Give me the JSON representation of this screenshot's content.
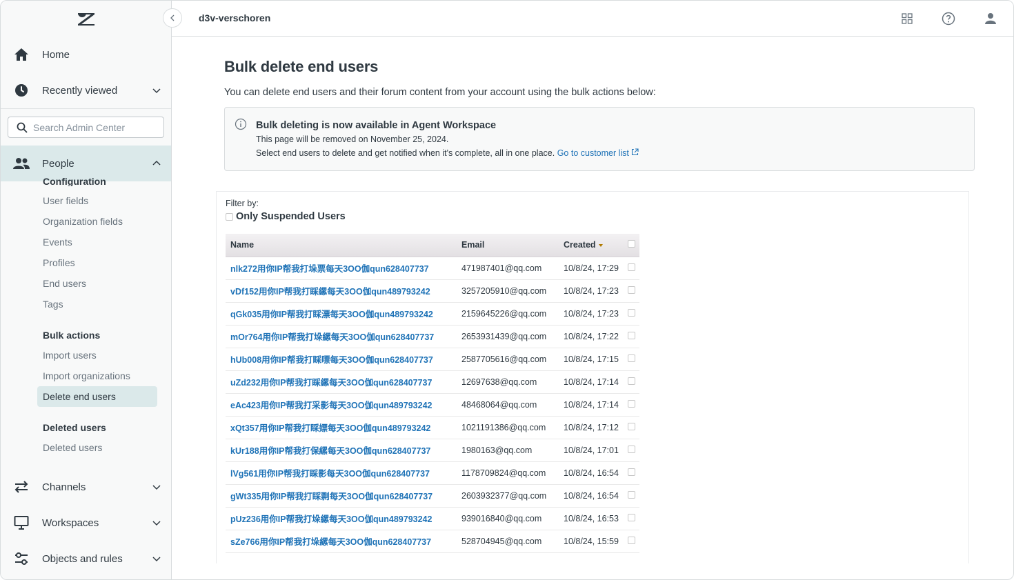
{
  "header": {
    "account_name": "d3v-verschoren"
  },
  "sidebar": {
    "home_label": "Home",
    "recently_viewed_label": "Recently viewed",
    "search_placeholder": "Search Admin Center",
    "people_label": "People",
    "clipped_section": "Configuration",
    "config_items": [
      "User fields",
      "Organization fields",
      "Events",
      "Profiles",
      "End users",
      "Tags"
    ],
    "bulk_actions_heading": "Bulk actions",
    "bulk_items": [
      "Import users",
      "Import organizations",
      "Delete end users"
    ],
    "deleted_heading": "Deleted users",
    "deleted_items": [
      "Deleted users"
    ],
    "channels_label": "Channels",
    "workspaces_label": "Workspaces",
    "objects_label": "Objects and rules"
  },
  "main": {
    "title": "Bulk delete end users",
    "intro": "You can delete end users and their forum content from your account using the bulk actions below:",
    "notice": {
      "title": "Bulk deleting is now available in Agent Workspace",
      "line1": "This page will be removed on November 25, 2024.",
      "line2": "Select end users to delete and get notified when it's complete, all in one place.",
      "link": "Go to customer list"
    },
    "filter": {
      "label": "Filter by:",
      "option": "Only Suspended Users"
    },
    "table": {
      "headers": {
        "name": "Name",
        "email": "Email",
        "created": "Created"
      },
      "rows": [
        {
          "name": "nlk272用你IP帮我打垛票每天3OO伽qun628407737",
          "email": "471987401@qq.com",
          "created": "10/8/24, 17:29"
        },
        {
          "name": "vDf152用你IP帮我打睬縲每天3OO伽qun489793242",
          "email": "3257205910@qq.com",
          "created": "10/8/24, 17:23"
        },
        {
          "name": "qGk035用你IP帮我打睬漂每天3OO伽qun489793242",
          "email": "2159645226@qq.com",
          "created": "10/8/24, 17:23"
        },
        {
          "name": "mOr764用你IP帮我打垛縲每天3OO伽qun628407737",
          "email": "2653931439@qq.com",
          "created": "10/8/24, 17:22"
        },
        {
          "name": "hUb008用你IP帮我打睬嘌每天3OO伽qun628407737",
          "email": "2587705616@qq.com",
          "created": "10/8/24, 17:15"
        },
        {
          "name": "uZd232用你IP帮我打睬縲每天3OO伽qun628407737",
          "email": "12697638@qq.com",
          "created": "10/8/24, 17:14"
        },
        {
          "name": "eAc423用你IP帮我打采影每天3OO伽qun489793242",
          "email": "48468064@qq.com",
          "created": "10/8/24, 17:14"
        },
        {
          "name": "xQt357用你IP帮我打睬嫖每天3OO伽qun489793242",
          "email": "1021191386@qq.com",
          "created": "10/8/24, 17:12"
        },
        {
          "name": "kUr188用你IP帮我打保縲每天3OO伽qun628407737",
          "email": "1980163@qq.com",
          "created": "10/8/24, 17:01"
        },
        {
          "name": "lVg561用你IP帮我打睬影每天3OO伽qun628407737",
          "email": "1178709824@qq.com",
          "created": "10/8/24, 16:54"
        },
        {
          "name": "gWt335用你IP帮我打睬剽每天3OO伽qun628407737",
          "email": "2603932377@qq.com",
          "created": "10/8/24, 16:54"
        },
        {
          "name": "pUz236用你IP帮我打垛縲每天3OO伽qun489793242",
          "email": "939016840@qq.com",
          "created": "10/8/24, 16:53"
        },
        {
          "name": "sZe766用你IP帮我打垛縲每天3OO伽qun628407737",
          "email": "528704945@qq.com",
          "created": "10/8/24, 15:59"
        }
      ]
    }
  },
  "colors": {
    "accent": "#1f73b7",
    "active_bg": "#dbe9ea",
    "sidebar_bg": "#f8f9f9",
    "text": "#2f3941",
    "muted": "#68737d"
  },
  "icons": {
    "logo": "zendesk-logo",
    "home": "home-icon",
    "recent": "clock-icon",
    "search": "search-icon",
    "people": "people-icon",
    "channels": "arrows-icon",
    "workspaces": "monitor-icon",
    "objects": "sliders-icon",
    "apps": "grid-icon",
    "help": "help-icon",
    "user": "user-icon"
  }
}
